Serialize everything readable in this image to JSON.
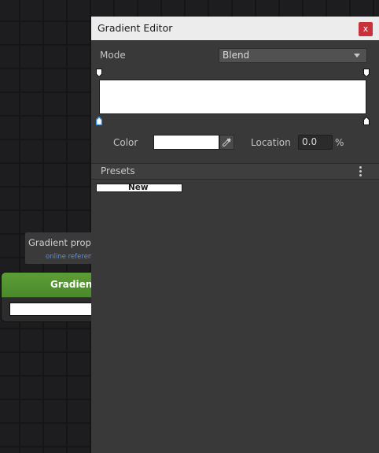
{
  "background_node": {
    "tooltip_title": "Gradient prope",
    "tooltip_link": "online referenc",
    "node_title": "Gradient"
  },
  "window": {
    "title": "Gradient Editor",
    "close_glyph": "x"
  },
  "mode": {
    "label": "Mode",
    "value": "Blend"
  },
  "gradient": {
    "start_color": "#ffffff",
    "end_color": "#ffffff"
  },
  "color": {
    "label": "Color",
    "value_hex": "#ffffff",
    "picker_icon": "eyedropper-icon"
  },
  "location": {
    "label": "Location",
    "value": "0.0",
    "unit": "%"
  },
  "presets": {
    "title": "Presets",
    "menu_icon": "kebab-menu-icon",
    "items": [
      {
        "label": "New"
      }
    ]
  },
  "colors": {
    "node_header": "#5e9c36",
    "close_button": "#c8313a",
    "link": "#5c8fd6",
    "selected_marker": "#3c89d6"
  }
}
